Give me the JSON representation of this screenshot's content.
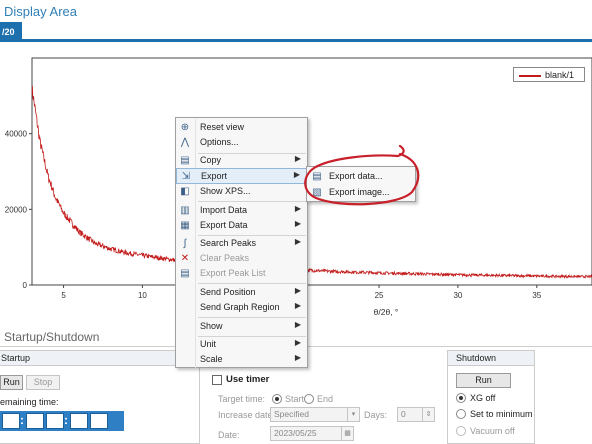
{
  "window": {
    "title": "Display Area",
    "tab_label": "/20"
  },
  "chart_data": {
    "type": "line",
    "series": [
      {
        "name": "blank/1",
        "x": [
          3,
          3.5,
          4,
          4.5,
          5,
          6,
          7,
          8,
          9,
          10,
          12,
          15,
          18,
          20,
          22,
          25,
          28,
          30,
          33,
          36,
          38.5
        ],
        "y": [
          52000,
          38000,
          29000,
          23000,
          19000,
          14000,
          11000,
          9500,
          8500,
          7800,
          6600,
          5600,
          4600,
          4000,
          3600,
          3200,
          2900,
          2700,
          2500,
          2300,
          2200
        ]
      }
    ],
    "x_ticks": [
      "5",
      "10",
      "25",
      "30",
      "35"
    ],
    "y_ticks": [
      "0",
      "20000",
      "40000"
    ],
    "xlabel": "θ/2θ, °",
    "ylabel": "",
    "xlim": [
      3,
      38.5
    ],
    "ylim": [
      0,
      60000
    ],
    "grid": false,
    "legend": "top-right",
    "line_color": "#c31a1a"
  },
  "context_menu": {
    "items": [
      {
        "label": "Reset view",
        "icon": "zoom-reset-icon",
        "submenu": false,
        "disabled": false
      },
      {
        "label": "Options...",
        "icon": "options-chart-icon",
        "submenu": false,
        "disabled": false
      },
      {
        "label": "Copy",
        "icon": "copy-icon",
        "submenu": true,
        "disabled": false
      },
      {
        "label": "Export",
        "icon": "export-icon",
        "submenu": true,
        "disabled": false,
        "highlighted": true
      },
      {
        "label": "Show XPS...",
        "icon": "xps-icon",
        "submenu": false,
        "disabled": false
      },
      {
        "label": "Import Data",
        "icon": "import-data-icon",
        "submenu": true,
        "disabled": false
      },
      {
        "label": "Export Data",
        "icon": "export-data-icon",
        "submenu": true,
        "disabled": false
      },
      {
        "label": "Search Peaks",
        "icon": "search-peaks-icon",
        "submenu": true,
        "disabled": false
      },
      {
        "label": "Clear Peaks",
        "icon": "clear-peaks-icon",
        "submenu": false,
        "disabled": true
      },
      {
        "label": "Export Peak List",
        "icon": "peak-list-icon",
        "submenu": false,
        "disabled": true
      },
      {
        "label": "Send Position",
        "icon": "",
        "submenu": true,
        "disabled": false
      },
      {
        "label": "Send Graph Region",
        "icon": "",
        "submenu": true,
        "disabled": false
      },
      {
        "label": "Show",
        "icon": "",
        "submenu": true,
        "disabled": false
      },
      {
        "label": "Unit",
        "icon": "",
        "submenu": true,
        "disabled": false
      },
      {
        "label": "Scale",
        "icon": "",
        "submenu": true,
        "disabled": false
      }
    ]
  },
  "export_submenu": {
    "items": [
      {
        "label": "Export data...",
        "icon": "export-data-file-icon"
      },
      {
        "label": "Export image...",
        "icon": "export-image-file-icon"
      }
    ]
  },
  "startup_shutdown": {
    "section_title": "Startup/Shutdown",
    "startup": {
      "header": "Startup",
      "run_label": "Run",
      "stop_label": "Stop",
      "remaining_label": "emaining time:",
      "timer_color": "#2f7fc4"
    },
    "timer": {
      "use_timer_label": "Use timer",
      "target_time_label": "Target time:",
      "start_label": "Start",
      "end_label": "End",
      "increase_date_label": "Increase date:",
      "increase_date_value": "Specified",
      "days_label": "Days:",
      "days_value": "0",
      "date_label": "Date:",
      "date_value": "2023/05/25"
    },
    "shutdown": {
      "header": "Shutdown",
      "run_label": "Run",
      "options": [
        {
          "label": "XG off",
          "selected": true,
          "disabled": false
        },
        {
          "label": "Set to minimum",
          "selected": false,
          "disabled": false
        },
        {
          "label": "Vacuum off",
          "selected": false,
          "disabled": true
        }
      ]
    }
  },
  "colors": {
    "accent": "#1e6fae",
    "annotation": "#c8202a",
    "highlight": "#e3eef8"
  }
}
